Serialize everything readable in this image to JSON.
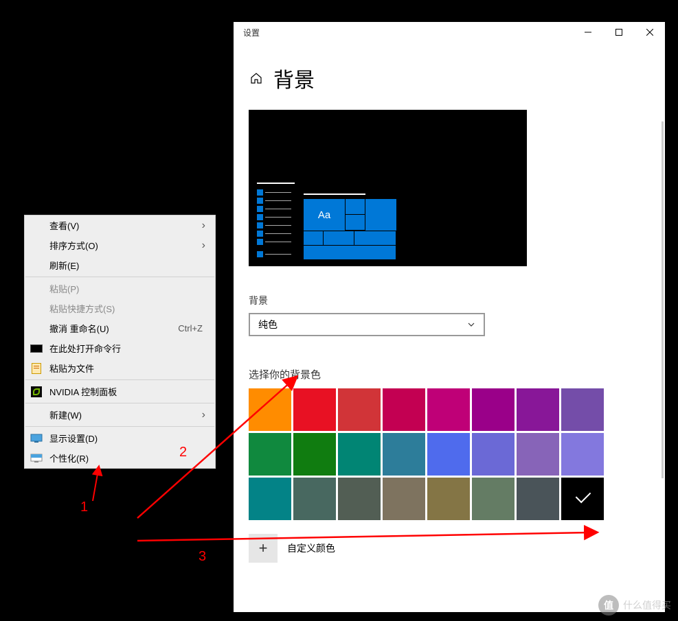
{
  "settings": {
    "window_title": "设置",
    "page_title": "背景",
    "preview_sample": "Aa",
    "bg_label": "背景",
    "bg_dropdown_value": "纯色",
    "choose_color_label": "选择你的背景色",
    "custom_color_label": "自定义颜色",
    "plus_symbol": "+",
    "colors": [
      {
        "hex": "#ff8c00"
      },
      {
        "hex": "#e81123"
      },
      {
        "hex": "#d13438"
      },
      {
        "hex": "#c30052"
      },
      {
        "hex": "#bf0077"
      },
      {
        "hex": "#9a0089"
      },
      {
        "hex": "#881798"
      },
      {
        "hex": "#744da9"
      },
      {
        "hex": "#10893e"
      },
      {
        "hex": "#107c10"
      },
      {
        "hex": "#018574"
      },
      {
        "hex": "#2d7d9a"
      },
      {
        "hex": "#4f6bed"
      },
      {
        "hex": "#6b69d6"
      },
      {
        "hex": "#8764b8"
      },
      {
        "hex": "#8378de"
      },
      {
        "hex": "#038387"
      },
      {
        "hex": "#486860"
      },
      {
        "hex": "#525e54"
      },
      {
        "hex": "#7e735f"
      },
      {
        "hex": "#847545"
      },
      {
        "hex": "#647c64"
      },
      {
        "hex": "#4a5459"
      },
      {
        "hex": "#000000",
        "selected": true
      }
    ]
  },
  "context_menu": {
    "items": [
      {
        "label": "查看(V)",
        "arrow": true
      },
      {
        "label": "排序方式(O)",
        "arrow": true
      },
      {
        "label": "刷新(E)"
      },
      {
        "sep": true
      },
      {
        "label": "粘贴(P)",
        "disabled": true
      },
      {
        "label": "粘贴快捷方式(S)",
        "disabled": true
      },
      {
        "label": "撤消 重命名(U)",
        "shortcut": "Ctrl+Z"
      },
      {
        "label": "在此处打开命令行",
        "icon": "cmd"
      },
      {
        "label": "粘贴为文件",
        "icon": "paste"
      },
      {
        "sep": true
      },
      {
        "label": "NVIDIA 控制面板",
        "icon": "nvidia"
      },
      {
        "sep": true
      },
      {
        "label": "新建(W)",
        "arrow": true
      },
      {
        "sep": true
      },
      {
        "label": "显示设置(D)",
        "icon": "display"
      },
      {
        "label": "个性化(R)",
        "icon": "personalize"
      }
    ]
  },
  "annotations": {
    "n1": "1",
    "n2": "2",
    "n3": "3"
  },
  "watermark": {
    "icon": "值",
    "text": "什么值得买"
  }
}
